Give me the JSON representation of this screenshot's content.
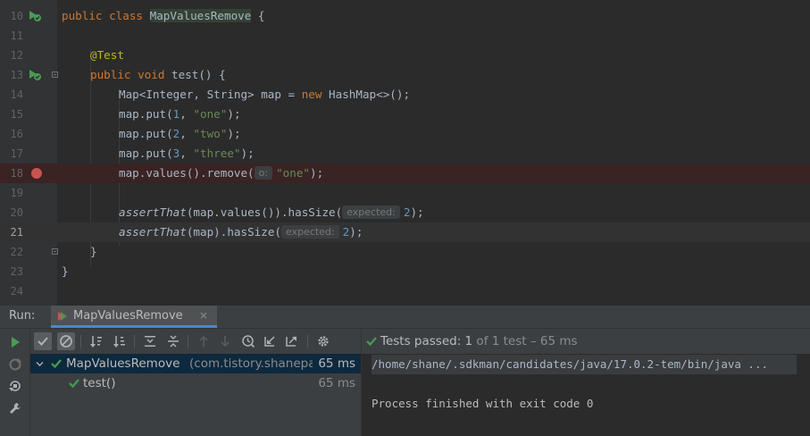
{
  "editor": {
    "lines": [
      {
        "n": "10"
      },
      {
        "n": "11"
      },
      {
        "n": "12"
      },
      {
        "n": "13"
      },
      {
        "n": "14"
      },
      {
        "n": "15"
      },
      {
        "n": "16"
      },
      {
        "n": "17"
      },
      {
        "n": "18"
      },
      {
        "n": "19"
      },
      {
        "n": "20"
      },
      {
        "n": "21"
      },
      {
        "n": "22"
      },
      {
        "n": "23"
      },
      {
        "n": "24"
      }
    ],
    "t": {
      "public": "public",
      "class": "class",
      "void": "void",
      "new": "new",
      "class_name": "MapValuesRemove",
      "brace_open": " {",
      "annotation": "@Test",
      "method_sig": " test() {",
      "l14a": "Map<Integer, String> map = ",
      "l14b": " HashMap<>();",
      "put": "map.put(",
      "comma": ", ",
      "close": ");",
      "n1": "1",
      "n2": "2",
      "n3": "3",
      "s_one": "\"one\"",
      "s_two": "\"two\"",
      "s_three": "\"three\"",
      "l18a": "map.values().remove(",
      "hint_o": "o:",
      "assertThat": "assertThat",
      "l20a": "(map.values()).hasSize(",
      "l21a": "(map).hasSize(",
      "hint_expected": "expected:",
      "num2": "2",
      "rbrace": "}"
    },
    "colors": {
      "keyword": "#cc7832",
      "string": "#6a8759",
      "number": "#6897bb",
      "annotation": "#bbb529"
    }
  },
  "run": {
    "label": "Run:",
    "tab_label": "MapValuesRemove",
    "tab_close": "×",
    "status": {
      "icon": "check-icon",
      "prefix": "Tests passed: ",
      "count": "1",
      "suffix": " of 1 test – 65 ms"
    },
    "tree": [
      {
        "name": "MapValuesRemove",
        "detail": " (com.tistory.shanepa",
        "duration": "65 ms",
        "selected": true
      },
      {
        "name": "test()",
        "duration": "65 ms",
        "selected": false
      }
    ],
    "console": [
      "/home/shane/.sdkman/candidates/java/17.0.2-tem/bin/java ...",
      "",
      "Process finished with exit code 0"
    ],
    "toolbar_icons": [
      "show-passed-icon",
      "show-ignored-icon",
      "sort-alpha-icon",
      "sort-duration-icon",
      "expand-all-icon",
      "collapse-all-icon",
      "previous-test-icon",
      "next-test-icon",
      "history-icon",
      "import-tests-icon",
      "export-tests-icon",
      "settings-icon"
    ],
    "accent": "#499c54"
  }
}
